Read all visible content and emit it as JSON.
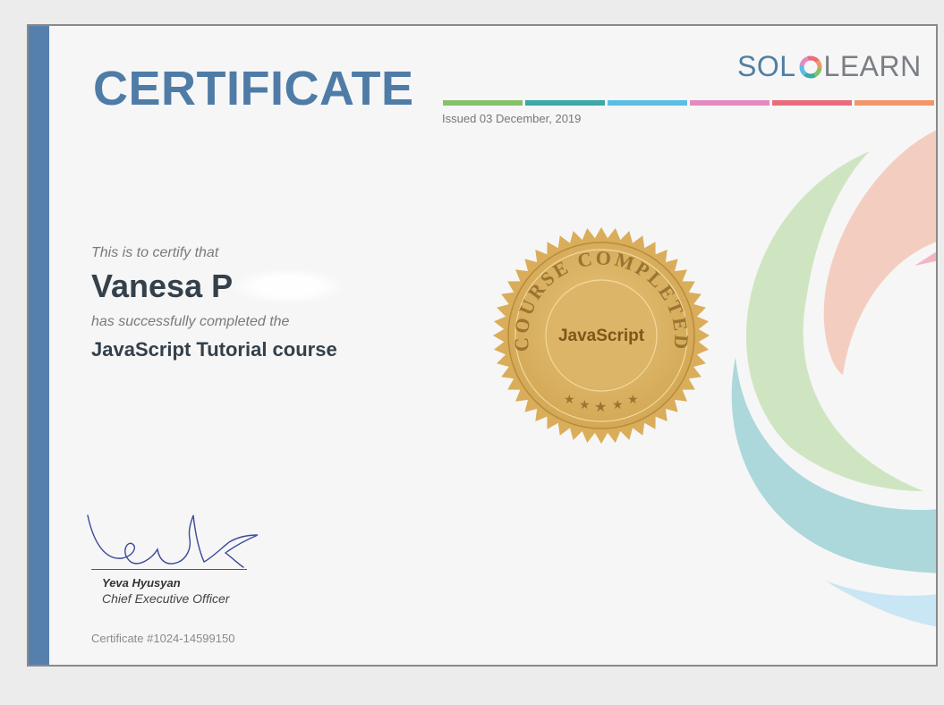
{
  "certificate": {
    "title": "CERTIFICATE",
    "issued": "Issued 03 December, 2019",
    "lead_text": "This is to certify that",
    "recipient_name": "Vanesa P",
    "completed_text": "has successfully completed the",
    "course_name": "JavaScript Tutorial course",
    "seal": {
      "arc_text": "COURSE COMPLETED",
      "center_text": "JavaScript"
    },
    "signer_name": "Yeva Hyusyan",
    "signer_role": "Chief Executive Officer",
    "certificate_number": "Certificate #1024-14599150"
  },
  "logo": {
    "left": "SOL",
    "right": "LEARN"
  },
  "colors": {
    "accent_blue": "#4f7ba7",
    "side_bar": "#5580ad",
    "seal_gold": "#dcb568",
    "strip_colors": [
      "#86c06a",
      "#3aa9a7",
      "#5bbde4",
      "#e58ac0",
      "#ea6b7b",
      "#f2976a"
    ]
  },
  "icons": {
    "logo_ring": "sololearn-ring-icon",
    "seal": "gold-seal-icon",
    "signature": "signature-image"
  }
}
